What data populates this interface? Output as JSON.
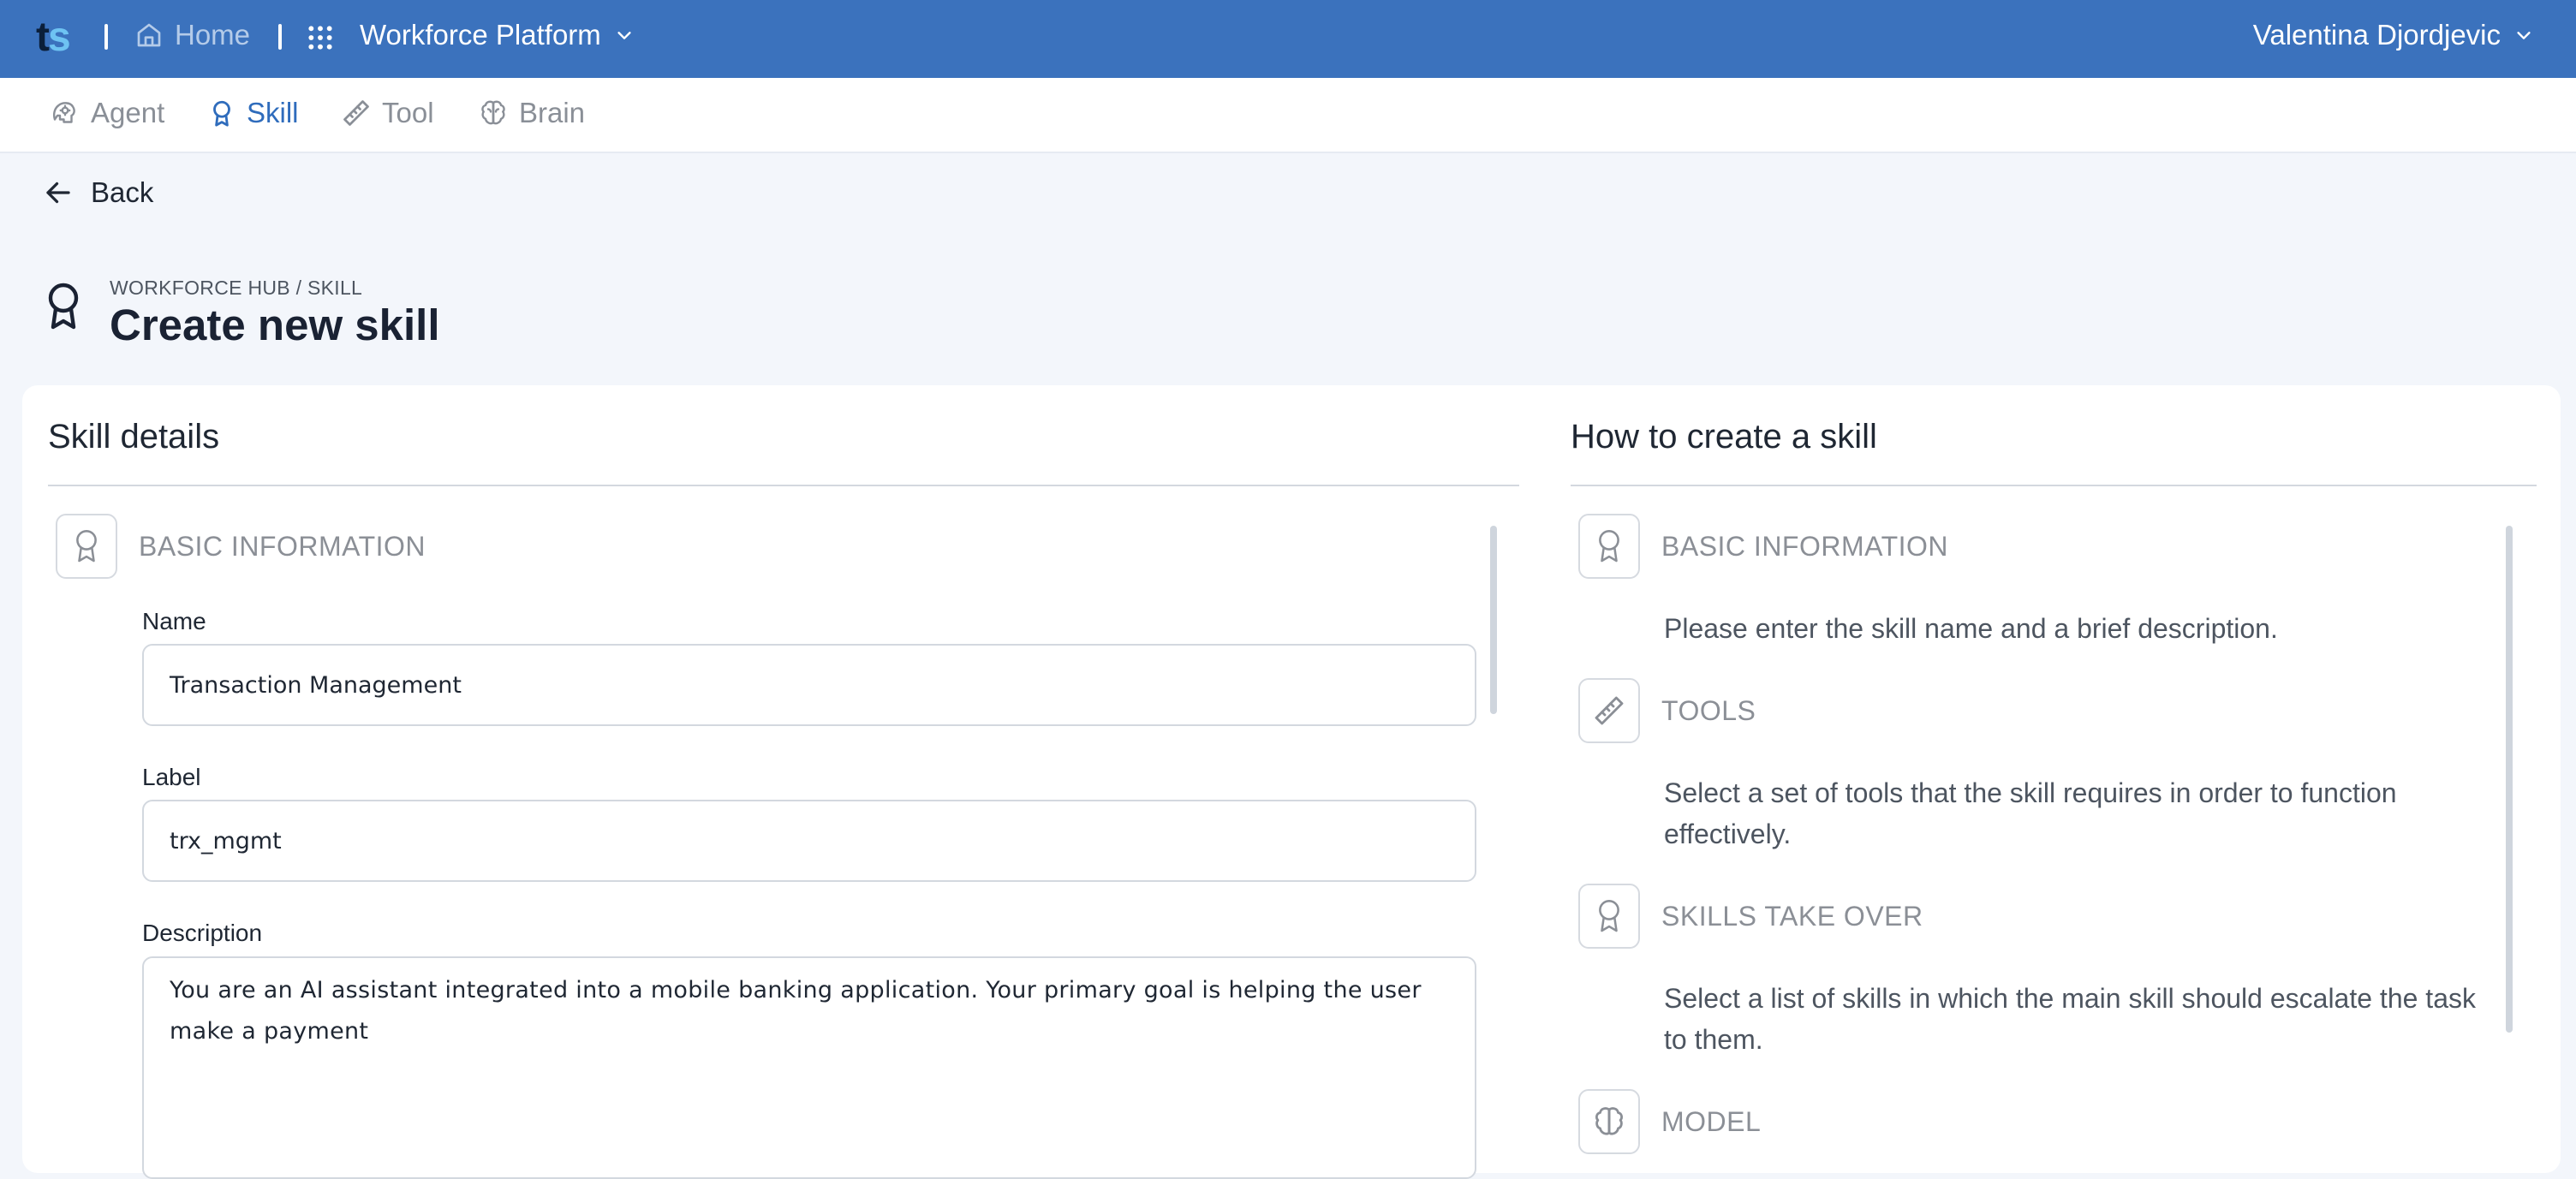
{
  "topbar": {
    "logo_t": "t",
    "logo_s": "s",
    "home_label": "Home",
    "platform_label": "Workforce Platform",
    "user_name": "Valentina Djordjevic"
  },
  "nav": {
    "tabs": [
      {
        "label": "Agent",
        "icon": "agent-icon",
        "active": false
      },
      {
        "label": "Skill",
        "icon": "award-icon",
        "active": true
      },
      {
        "label": "Tool",
        "icon": "ruler-icon",
        "active": false
      },
      {
        "label": "Brain",
        "icon": "brain-icon",
        "active": false
      }
    ]
  },
  "header": {
    "back_label": "Back",
    "breadcrumb": "WORKFORCE HUB / SKILL",
    "title": "Create new skill"
  },
  "form": {
    "title": "Skill details",
    "section_label": "BASIC INFORMATION",
    "name_label": "Name",
    "name_value": "Transaction Management",
    "label_label": "Label",
    "label_value": "trx_mgmt",
    "description_label": "Description",
    "description_value": "You are an AI assistant integrated into a mobile banking application. Your primary goal is helping the user make a payment"
  },
  "help": {
    "title": "How to create a skill",
    "steps": [
      {
        "label": "BASIC INFORMATION",
        "icon": "award-icon",
        "text": "Please enter the skill name and a brief description."
      },
      {
        "label": "TOOLS",
        "icon": "ruler-icon",
        "text": "Select a set of tools that the skill requires in order to function effectively."
      },
      {
        "label": "SKILLS TAKE OVER",
        "icon": "award-icon",
        "text": "Select a list of skills in which the main skill should escalate the task to them."
      },
      {
        "label": "MODEL",
        "icon": "brain-icon",
        "text": ""
      }
    ]
  },
  "colors": {
    "topbar": "#3b72bd",
    "active_tab": "#2f6cbc",
    "background": "#f3f6fb"
  }
}
